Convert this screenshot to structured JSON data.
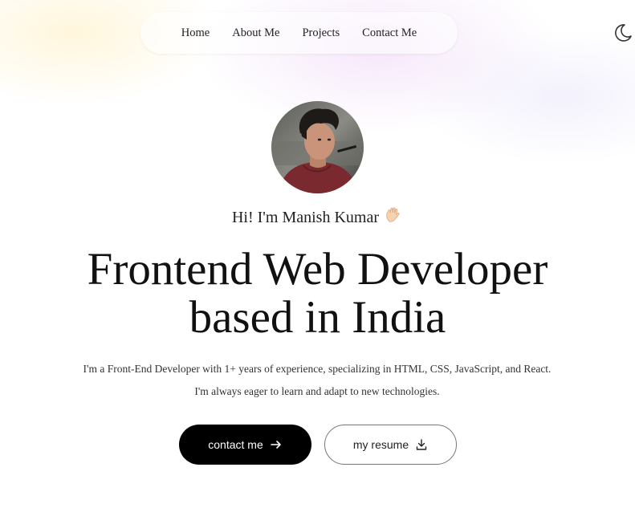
{
  "nav": {
    "items": [
      {
        "label": "Home"
      },
      {
        "label": "About Me"
      },
      {
        "label": "Projects"
      },
      {
        "label": "Contact Me"
      }
    ]
  },
  "header": {
    "theme_toggle_icon": "moon-icon"
  },
  "hero": {
    "greeting": "Hi! I'm Manish Kumar",
    "greeting_icon": "waving-hand-icon",
    "headline_line1": "Frontend Web Developer",
    "headline_line2": "based in India",
    "bio": "I'm a Front-End Developer with 1+ years of experience, specializing in HTML, CSS, JavaScript, and React. I'm always eager to learn and adapt to new technologies.",
    "primary_button": {
      "label": "contact me",
      "icon": "arrow-right-icon"
    },
    "secondary_button": {
      "label": "my resume",
      "icon": "download-icon"
    }
  },
  "colors": {
    "primary_button_bg": "#000000",
    "primary_button_text": "#ffffff",
    "text": "#111111"
  }
}
